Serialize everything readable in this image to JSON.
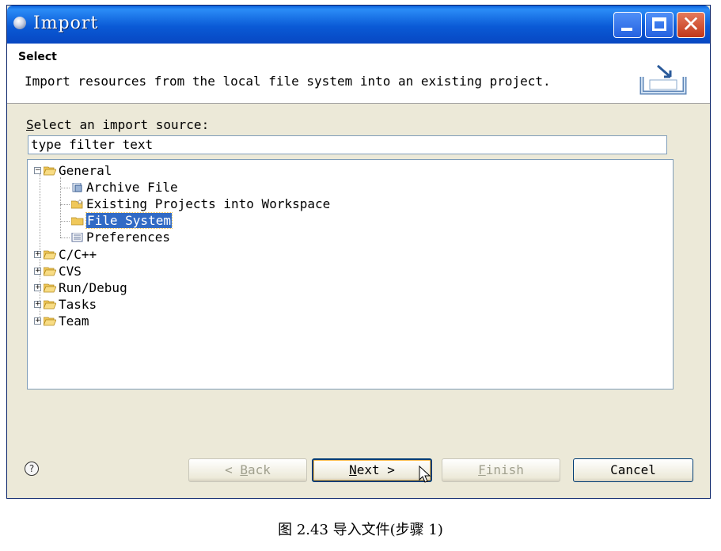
{
  "window": {
    "title": "Import"
  },
  "banner": {
    "title": "Select",
    "description": "Import resources from the local file system into an existing project."
  },
  "source": {
    "label_prefix": "S",
    "label_rest": "elect an import source:",
    "filter_value": "type filter text"
  },
  "tree": {
    "general": "General",
    "archive": "Archive File",
    "existing": "Existing Projects into Workspace",
    "filesystem": "File System",
    "preferences": "Preferences",
    "cpp": "C/C++",
    "cvs": "CVS",
    "rundebug": "Run/Debug",
    "tasks": "Tasks",
    "team": "Team"
  },
  "buttons": {
    "back_pre": "< ",
    "back_u": "B",
    "back_post": "ack",
    "next_u": "N",
    "next_post": "ext >",
    "finish_u": "F",
    "finish_post": "inish",
    "cancel": "Cancel",
    "help": "?"
  },
  "caption": "图 2.43 导入文件(步骤 1)",
  "colors": {
    "titlebar": "#0a5ad6",
    "selection": "#316ac5",
    "dialog_bg": "#ece9d8"
  }
}
